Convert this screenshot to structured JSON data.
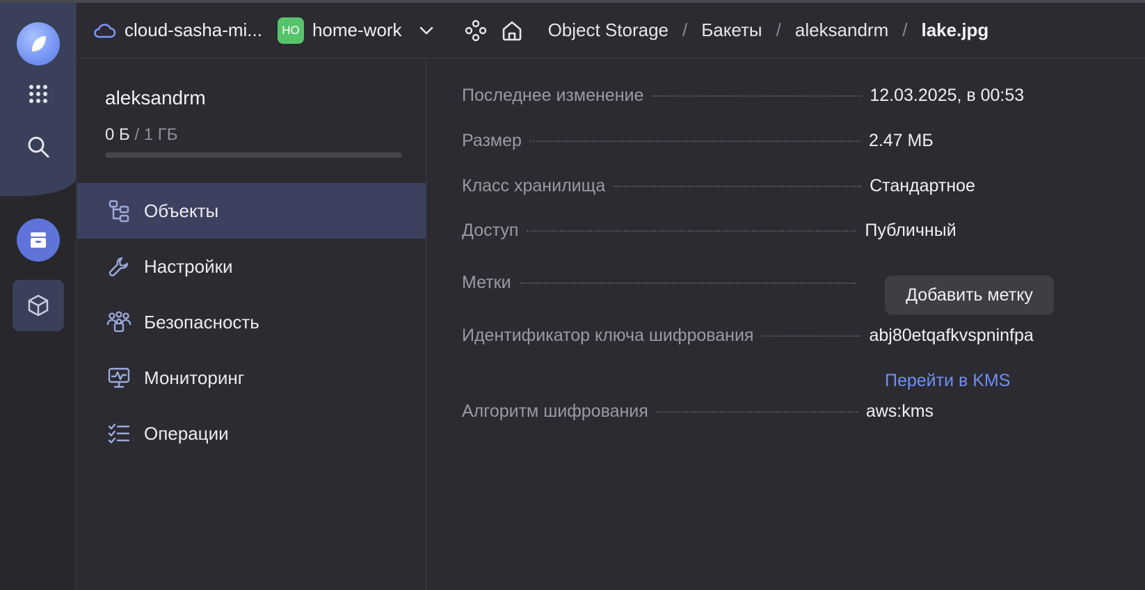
{
  "header": {
    "cloud_label": "cloud-sasha-mi...",
    "folder_badge": "НО",
    "folder_label": "home-work",
    "breadcrumbs": [
      "Object Storage",
      "Бакеты",
      "aleksandrm",
      "lake.jpg"
    ]
  },
  "sidebar": {
    "bucket_name": "aleksandrm",
    "usage_used": "0 Б",
    "usage_sep": "/",
    "usage_total": "1 ГБ",
    "usage_fraction": 0,
    "items": [
      {
        "label": "Объекты",
        "icon": "objects-icon",
        "active": true
      },
      {
        "label": "Настройки",
        "icon": "wrench-icon",
        "active": false
      },
      {
        "label": "Безопасность",
        "icon": "security-icon",
        "active": false
      },
      {
        "label": "Мониторинг",
        "icon": "monitoring-icon",
        "active": false
      },
      {
        "label": "Операции",
        "icon": "operations-icon",
        "active": false
      }
    ]
  },
  "details": {
    "rows": [
      {
        "key": "Последнее изменение",
        "value": "12.03.2025, в 00:53"
      },
      {
        "key": "Размер",
        "value": "2.47 МБ"
      },
      {
        "key": "Класс хранилища",
        "value": "Стандартное"
      },
      {
        "key": "Доступ",
        "value": "Публичный"
      },
      {
        "key": "Метки",
        "value": ""
      },
      {
        "key": "Идентификатор ключа шифрования",
        "value": "abj80etqafkvspninfpa"
      },
      {
        "key": "Алгоритм шифрования",
        "value": "aws:kms"
      }
    ],
    "add_tag_label": "Добавить метку",
    "kms_link": "Перейти в KMS"
  },
  "colors": {
    "accent": "#5f73d8",
    "link": "#6f8ff5",
    "folder_badge": "#56c46b",
    "active_nav": "#3d4160"
  }
}
